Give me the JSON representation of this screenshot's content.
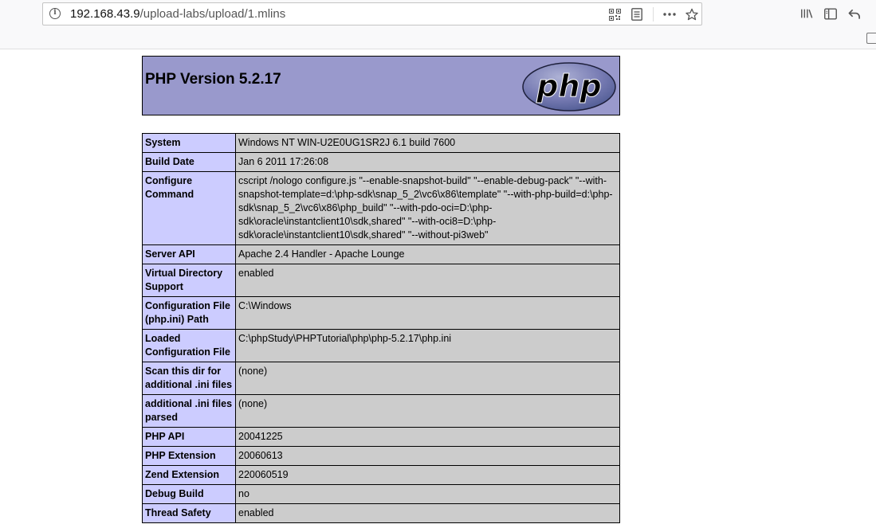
{
  "browser": {
    "url_host": "192.168.43.9",
    "url_path": "/upload-labs/upload/1.mlins"
  },
  "php": {
    "title": "PHP Version 5.2.17",
    "logo_text": "php"
  },
  "rows": [
    {
      "key": "System",
      "value": "Windows NT WIN-U2E0UG1SR2J 6.1 build 7600"
    },
    {
      "key": "Build Date",
      "value": "Jan 6 2011 17:26:08"
    },
    {
      "key": "Configure Command",
      "value": "cscript /nologo configure.js \"--enable-snapshot-build\" \"--enable-debug-pack\" \"--with-snapshot-template=d:\\php-sdk\\snap_5_2\\vc6\\x86\\template\" \"--with-php-build=d:\\php-sdk\\snap_5_2\\vc6\\x86\\php_build\" \"--with-pdo-oci=D:\\php-sdk\\oracle\\instantclient10\\sdk,shared\" \"--with-oci8=D:\\php-sdk\\oracle\\instantclient10\\sdk,shared\" \"--without-pi3web\""
    },
    {
      "key": "Server API",
      "value": "Apache 2.4 Handler - Apache Lounge"
    },
    {
      "key": "Virtual Directory Support",
      "value": "enabled"
    },
    {
      "key": "Configuration File (php.ini) Path",
      "value": "C:\\Windows"
    },
    {
      "key": "Loaded Configuration File",
      "value": "C:\\phpStudy\\PHPTutorial\\php\\php-5.2.17\\php.ini"
    },
    {
      "key": "Scan this dir for additional .ini files",
      "value": "(none)"
    },
    {
      "key": "additional .ini files parsed",
      "value": "(none)"
    },
    {
      "key": "PHP API",
      "value": "20041225"
    },
    {
      "key": "PHP Extension",
      "value": "20060613"
    },
    {
      "key": "Zend Extension",
      "value": "220060519"
    },
    {
      "key": "Debug Build",
      "value": "no"
    },
    {
      "key": "Thread Safety",
      "value": "enabled"
    }
  ]
}
